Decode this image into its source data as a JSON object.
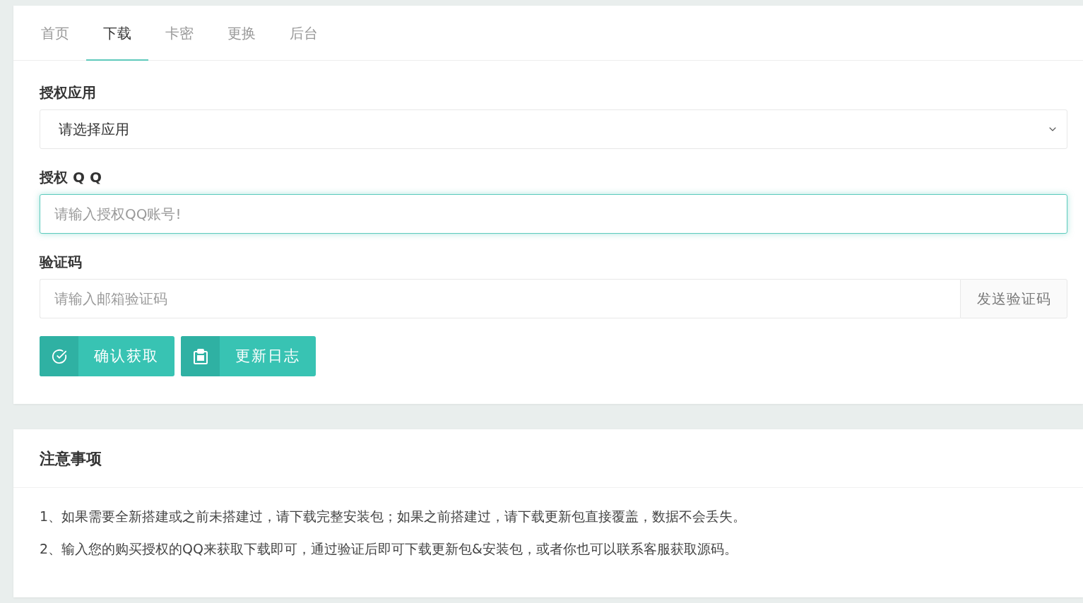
{
  "tabs": [
    {
      "label": "首页",
      "selected": false
    },
    {
      "label": "下载",
      "selected": true
    },
    {
      "label": "卡密",
      "selected": false
    },
    {
      "label": "更换",
      "selected": false
    },
    {
      "label": "后台",
      "selected": false
    }
  ],
  "form": {
    "fields": [
      {
        "kind": "select",
        "label": "授权应用",
        "value": "请选择应用"
      },
      {
        "kind": "text",
        "label": "授权 Q Q",
        "placeholder": "请输入授权QQ账号!",
        "focused": true
      },
      {
        "kind": "code",
        "label": "验证码",
        "placeholder": "请输入邮箱验证码",
        "focused": false,
        "addon": "发送验证码"
      }
    ],
    "buttons": [
      {
        "kind": "confirm",
        "label": "确认获取"
      },
      {
        "kind": "changelog",
        "label": "更新日志"
      }
    ]
  },
  "notice": {
    "title": "注意事项",
    "items": [
      "1、如果需要全新搭建或之前未搭建过，请下载完整安装包；如果之前搭建过，请下载更新包直接覆盖，数据不会丢失。",
      "2、输入您的购买授权的QQ来获取下载即可，通过验证后即可下载更新包&安装包，或者你也可以联系客服获取源码。"
    ]
  }
}
